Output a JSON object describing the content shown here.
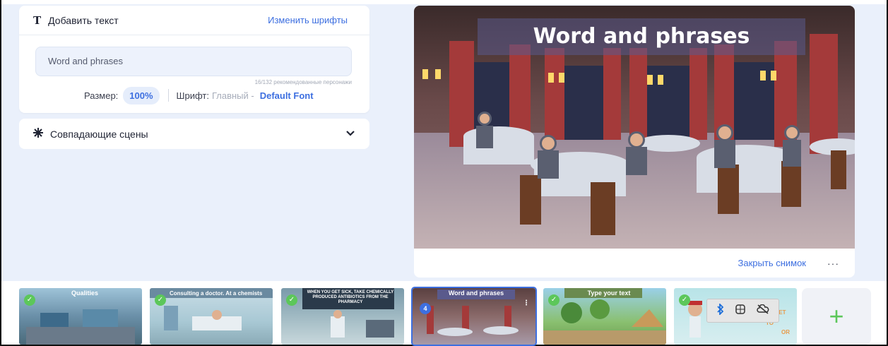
{
  "text_panel": {
    "title": "Добавить текст",
    "change_fonts": "Изменить шрифты",
    "input_value": "Word and phrases",
    "recommend_note": "16/132 рекомендованные персонажи",
    "size_label": "Размер:",
    "size_value": "100%",
    "font_label": "Шрифт:",
    "font_main": "Главный -",
    "font_default": "Default Font"
  },
  "scenes_panel": {
    "title": "Совпадающие сцены"
  },
  "preview": {
    "title": "Word and phrases",
    "close_snapshot": "Закрыть снимок",
    "more": "···"
  },
  "thumbnails": [
    {
      "caption": "Qualities",
      "checked": true
    },
    {
      "caption": "Consulting a doctor. At a chemists",
      "checked": true
    },
    {
      "caption": "WHEN YOU GET SICK, TAKE CHEMICALLY PRODUCED ANTIBIOTICS FROM THE PHARMACY",
      "checked": true
    },
    {
      "caption": "Word and phrases",
      "badge": "4",
      "active": true
    },
    {
      "caption": "Type your text",
      "checked": true
    },
    {
      "caption": "WHEN YOU GET",
      "caption2": "TO",
      "caption3": "OR",
      "checked": true
    }
  ],
  "add_button": "+",
  "colors": {
    "accent": "#3d6fe0",
    "check_green": "#5cc75a",
    "background": "#eaf0fb"
  }
}
